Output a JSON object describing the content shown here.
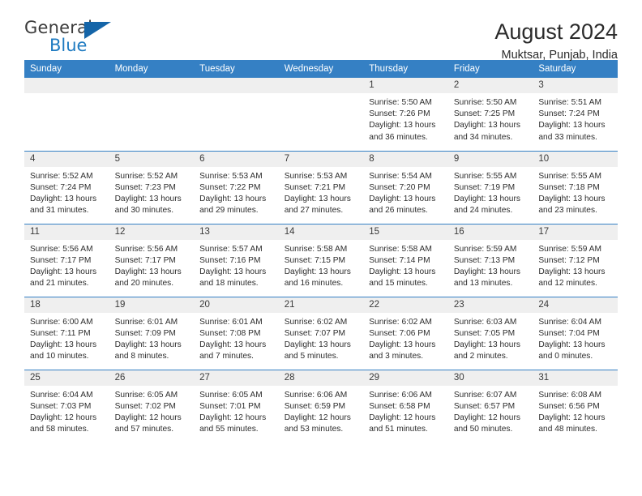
{
  "brand": {
    "name_part1": "General",
    "name_part2": "Blue",
    "mark": "triangle-logo",
    "accent_color": "#1565a8"
  },
  "header": {
    "title": "August 2024",
    "subtitle": "Muktsar, Punjab, India"
  },
  "colors": {
    "header_blue": "#3580c4",
    "daynum_grey": "#efefef",
    "text": "#2d2d2d"
  },
  "weekday_headers": [
    "Sunday",
    "Monday",
    "Tuesday",
    "Wednesday",
    "Thursday",
    "Friday",
    "Saturday"
  ],
  "weeks": [
    [
      {
        "day": "",
        "sunrise": "",
        "sunset": "",
        "daylight_line1": "",
        "daylight_line2": ""
      },
      {
        "day": "",
        "sunrise": "",
        "sunset": "",
        "daylight_line1": "",
        "daylight_line2": ""
      },
      {
        "day": "",
        "sunrise": "",
        "sunset": "",
        "daylight_line1": "",
        "daylight_line2": ""
      },
      {
        "day": "",
        "sunrise": "",
        "sunset": "",
        "daylight_line1": "",
        "daylight_line2": ""
      },
      {
        "day": "1",
        "sunrise": "Sunrise: 5:50 AM",
        "sunset": "Sunset: 7:26 PM",
        "daylight_line1": "Daylight: 13 hours",
        "daylight_line2": "and 36 minutes."
      },
      {
        "day": "2",
        "sunrise": "Sunrise: 5:50 AM",
        "sunset": "Sunset: 7:25 PM",
        "daylight_line1": "Daylight: 13 hours",
        "daylight_line2": "and 34 minutes."
      },
      {
        "day": "3",
        "sunrise": "Sunrise: 5:51 AM",
        "sunset": "Sunset: 7:24 PM",
        "daylight_line1": "Daylight: 13 hours",
        "daylight_line2": "and 33 minutes."
      }
    ],
    [
      {
        "day": "4",
        "sunrise": "Sunrise: 5:52 AM",
        "sunset": "Sunset: 7:24 PM",
        "daylight_line1": "Daylight: 13 hours",
        "daylight_line2": "and 31 minutes."
      },
      {
        "day": "5",
        "sunrise": "Sunrise: 5:52 AM",
        "sunset": "Sunset: 7:23 PM",
        "daylight_line1": "Daylight: 13 hours",
        "daylight_line2": "and 30 minutes."
      },
      {
        "day": "6",
        "sunrise": "Sunrise: 5:53 AM",
        "sunset": "Sunset: 7:22 PM",
        "daylight_line1": "Daylight: 13 hours",
        "daylight_line2": "and 29 minutes."
      },
      {
        "day": "7",
        "sunrise": "Sunrise: 5:53 AM",
        "sunset": "Sunset: 7:21 PM",
        "daylight_line1": "Daylight: 13 hours",
        "daylight_line2": "and 27 minutes."
      },
      {
        "day": "8",
        "sunrise": "Sunrise: 5:54 AM",
        "sunset": "Sunset: 7:20 PM",
        "daylight_line1": "Daylight: 13 hours",
        "daylight_line2": "and 26 minutes."
      },
      {
        "day": "9",
        "sunrise": "Sunrise: 5:55 AM",
        "sunset": "Sunset: 7:19 PM",
        "daylight_line1": "Daylight: 13 hours",
        "daylight_line2": "and 24 minutes."
      },
      {
        "day": "10",
        "sunrise": "Sunrise: 5:55 AM",
        "sunset": "Sunset: 7:18 PM",
        "daylight_line1": "Daylight: 13 hours",
        "daylight_line2": "and 23 minutes."
      }
    ],
    [
      {
        "day": "11",
        "sunrise": "Sunrise: 5:56 AM",
        "sunset": "Sunset: 7:17 PM",
        "daylight_line1": "Daylight: 13 hours",
        "daylight_line2": "and 21 minutes."
      },
      {
        "day": "12",
        "sunrise": "Sunrise: 5:56 AM",
        "sunset": "Sunset: 7:17 PM",
        "daylight_line1": "Daylight: 13 hours",
        "daylight_line2": "and 20 minutes."
      },
      {
        "day": "13",
        "sunrise": "Sunrise: 5:57 AM",
        "sunset": "Sunset: 7:16 PM",
        "daylight_line1": "Daylight: 13 hours",
        "daylight_line2": "and 18 minutes."
      },
      {
        "day": "14",
        "sunrise": "Sunrise: 5:58 AM",
        "sunset": "Sunset: 7:15 PM",
        "daylight_line1": "Daylight: 13 hours",
        "daylight_line2": "and 16 minutes."
      },
      {
        "day": "15",
        "sunrise": "Sunrise: 5:58 AM",
        "sunset": "Sunset: 7:14 PM",
        "daylight_line1": "Daylight: 13 hours",
        "daylight_line2": "and 15 minutes."
      },
      {
        "day": "16",
        "sunrise": "Sunrise: 5:59 AM",
        "sunset": "Sunset: 7:13 PM",
        "daylight_line1": "Daylight: 13 hours",
        "daylight_line2": "and 13 minutes."
      },
      {
        "day": "17",
        "sunrise": "Sunrise: 5:59 AM",
        "sunset": "Sunset: 7:12 PM",
        "daylight_line1": "Daylight: 13 hours",
        "daylight_line2": "and 12 minutes."
      }
    ],
    [
      {
        "day": "18",
        "sunrise": "Sunrise: 6:00 AM",
        "sunset": "Sunset: 7:11 PM",
        "daylight_line1": "Daylight: 13 hours",
        "daylight_line2": "and 10 minutes."
      },
      {
        "day": "19",
        "sunrise": "Sunrise: 6:01 AM",
        "sunset": "Sunset: 7:09 PM",
        "daylight_line1": "Daylight: 13 hours",
        "daylight_line2": "and 8 minutes."
      },
      {
        "day": "20",
        "sunrise": "Sunrise: 6:01 AM",
        "sunset": "Sunset: 7:08 PM",
        "daylight_line1": "Daylight: 13 hours",
        "daylight_line2": "and 7 minutes."
      },
      {
        "day": "21",
        "sunrise": "Sunrise: 6:02 AM",
        "sunset": "Sunset: 7:07 PM",
        "daylight_line1": "Daylight: 13 hours",
        "daylight_line2": "and 5 minutes."
      },
      {
        "day": "22",
        "sunrise": "Sunrise: 6:02 AM",
        "sunset": "Sunset: 7:06 PM",
        "daylight_line1": "Daylight: 13 hours",
        "daylight_line2": "and 3 minutes."
      },
      {
        "day": "23",
        "sunrise": "Sunrise: 6:03 AM",
        "sunset": "Sunset: 7:05 PM",
        "daylight_line1": "Daylight: 13 hours",
        "daylight_line2": "and 2 minutes."
      },
      {
        "day": "24",
        "sunrise": "Sunrise: 6:04 AM",
        "sunset": "Sunset: 7:04 PM",
        "daylight_line1": "Daylight: 13 hours",
        "daylight_line2": "and 0 minutes."
      }
    ],
    [
      {
        "day": "25",
        "sunrise": "Sunrise: 6:04 AM",
        "sunset": "Sunset: 7:03 PM",
        "daylight_line1": "Daylight: 12 hours",
        "daylight_line2": "and 58 minutes."
      },
      {
        "day": "26",
        "sunrise": "Sunrise: 6:05 AM",
        "sunset": "Sunset: 7:02 PM",
        "daylight_line1": "Daylight: 12 hours",
        "daylight_line2": "and 57 minutes."
      },
      {
        "day": "27",
        "sunrise": "Sunrise: 6:05 AM",
        "sunset": "Sunset: 7:01 PM",
        "daylight_line1": "Daylight: 12 hours",
        "daylight_line2": "and 55 minutes."
      },
      {
        "day": "28",
        "sunrise": "Sunrise: 6:06 AM",
        "sunset": "Sunset: 6:59 PM",
        "daylight_line1": "Daylight: 12 hours",
        "daylight_line2": "and 53 minutes."
      },
      {
        "day": "29",
        "sunrise": "Sunrise: 6:06 AM",
        "sunset": "Sunset: 6:58 PM",
        "daylight_line1": "Daylight: 12 hours",
        "daylight_line2": "and 51 minutes."
      },
      {
        "day": "30",
        "sunrise": "Sunrise: 6:07 AM",
        "sunset": "Sunset: 6:57 PM",
        "daylight_line1": "Daylight: 12 hours",
        "daylight_line2": "and 50 minutes."
      },
      {
        "day": "31",
        "sunrise": "Sunrise: 6:08 AM",
        "sunset": "Sunset: 6:56 PM",
        "daylight_line1": "Daylight: 12 hours",
        "daylight_line2": "and 48 minutes."
      }
    ]
  ]
}
